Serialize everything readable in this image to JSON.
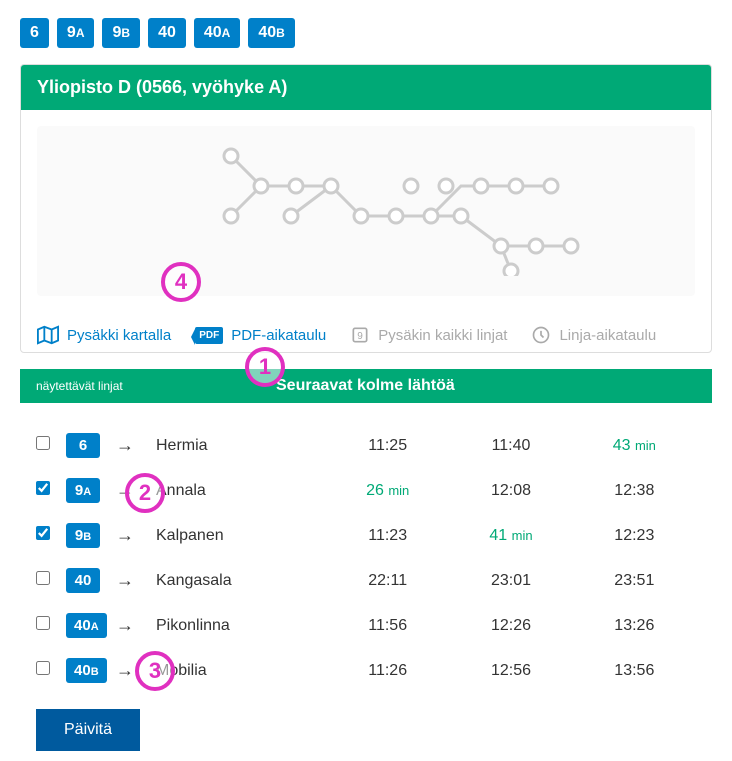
{
  "route_chips": [
    "6",
    "9A",
    "9B",
    "40",
    "40A",
    "40B"
  ],
  "stop": {
    "title": "Yliopisto D (0566, vyöhyke A)"
  },
  "actions": {
    "map": "Pysäkki kartalla",
    "pdf": "PDF-aikataulu",
    "alllines": "Pysäkin kaikki linjat",
    "linetimetable": "Linja-aikataulu"
  },
  "table": {
    "left_header": "näytettävät linjat",
    "right_header": "Seuraavat kolme lähtöä",
    "arrow": "→",
    "rows": [
      {
        "checked": false,
        "line": "6",
        "suffix": "",
        "dest": "Hermia",
        "t1": "11:25",
        "t1g": false,
        "t2": "11:40",
        "t2g": false,
        "t3": "43 min",
        "t3g": true
      },
      {
        "checked": true,
        "line": "9",
        "suffix": "A",
        "dest": "Annala",
        "t1": "26 min",
        "t1g": true,
        "t2": "12:08",
        "t2g": false,
        "t3": "12:38",
        "t3g": false
      },
      {
        "checked": true,
        "line": "9",
        "suffix": "B",
        "dest": "Kalpanen",
        "t1": "11:23",
        "t1g": false,
        "t2": "41 min",
        "t2g": true,
        "t3": "12:23",
        "t3g": false
      },
      {
        "checked": false,
        "line": "40",
        "suffix": "",
        "dest": "Kangasala",
        "t1": "22:11",
        "t1g": false,
        "t2": "23:01",
        "t2g": false,
        "t3": "23:51",
        "t3g": false
      },
      {
        "checked": false,
        "line": "40",
        "suffix": "A",
        "dest": "Pikonlinna",
        "t1": "11:56",
        "t1g": false,
        "t2": "12:26",
        "t2g": false,
        "t3": "13:26",
        "t3g": false
      },
      {
        "checked": false,
        "line": "40",
        "suffix": "B",
        "dest": "Mobilia",
        "t1": "11:26",
        "t1g": false,
        "t2": "12:56",
        "t2g": false,
        "t3": "13:56",
        "t3g": false
      }
    ]
  },
  "update_button": "Päivitä",
  "annotations": {
    "a1": "1",
    "a2": "2",
    "a3": "3",
    "a4": "4"
  }
}
